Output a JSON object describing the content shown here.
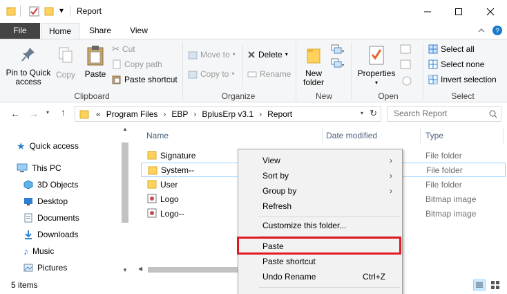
{
  "window": {
    "title": "Report",
    "quick_access_dropdown": "▾",
    "min_icon": "minimize-icon",
    "max_icon": "maximize-icon",
    "close_icon": "close-icon"
  },
  "ribbon_tabs": [
    "File",
    "Home",
    "Share",
    "View"
  ],
  "ribbon": {
    "clipboard": {
      "pin_label": "Pin to Quick access",
      "copy_label": "Copy",
      "paste_label": "Paste",
      "cut_label": "Cut",
      "copy_path_label": "Copy path",
      "paste_shortcut_label": "Paste shortcut",
      "group_label": "Clipboard"
    },
    "organize": {
      "move_to_label": "Move to",
      "copy_to_label": "Copy to",
      "delete_label": "Delete",
      "rename_label": "Rename",
      "group_label": "Organize"
    },
    "new": {
      "new_folder_label": "New folder",
      "group_label": "New"
    },
    "open": {
      "properties_label": "Properties",
      "group_label": "Open"
    },
    "select": {
      "select_all_label": "Select all",
      "select_none_label": "Select none",
      "invert_label": "Invert selection",
      "group_label": "Select"
    }
  },
  "address": {
    "prefix": "«",
    "crumbs": [
      "Program Files",
      "EBP",
      "BplusErp v3.1",
      "Report"
    ],
    "search_placeholder": "Search Report"
  },
  "nav": {
    "items": [
      {
        "label": "Quick access",
        "icon": "star-icon"
      },
      {
        "label": "This PC",
        "icon": "computer-icon"
      },
      {
        "label": "3D Objects",
        "icon": "cube-icon"
      },
      {
        "label": "Desktop",
        "icon": "desktop-icon"
      },
      {
        "label": "Documents",
        "icon": "documents-icon"
      },
      {
        "label": "Downloads",
        "icon": "download-icon"
      },
      {
        "label": "Music",
        "icon": "music-icon"
      },
      {
        "label": "Pictures",
        "icon": "pictures-icon"
      }
    ]
  },
  "columns": {
    "name": "Name",
    "date": "Date modified",
    "type": "Type"
  },
  "files": [
    {
      "name": "Signature",
      "type": "File folder",
      "icon": "folder-icon"
    },
    {
      "name": "System--",
      "type": "File folder",
      "icon": "folder-icon"
    },
    {
      "name": "User",
      "type": "File folder",
      "icon": "folder-icon"
    },
    {
      "name": "Logo",
      "type": "Bitmap image",
      "icon": "bitmap-icon"
    },
    {
      "name": "Logo--",
      "type": "Bitmap image",
      "icon": "bitmap-icon"
    }
  ],
  "status": {
    "items_count": "5 items"
  },
  "context_menu": {
    "view": "View",
    "sort_by": "Sort by",
    "group_by": "Group by",
    "refresh": "Refresh",
    "customize": "Customize this folder...",
    "paste": "Paste",
    "paste_shortcut": "Paste shortcut",
    "undo_rename": "Undo Rename",
    "undo_shortcut": "Ctrl+Z"
  },
  "colors": {
    "file_tab": "#444444",
    "accent_blue": "#1979ca",
    "highlight_red": "#e01a22",
    "folder_yellow": "#ffd25c"
  }
}
